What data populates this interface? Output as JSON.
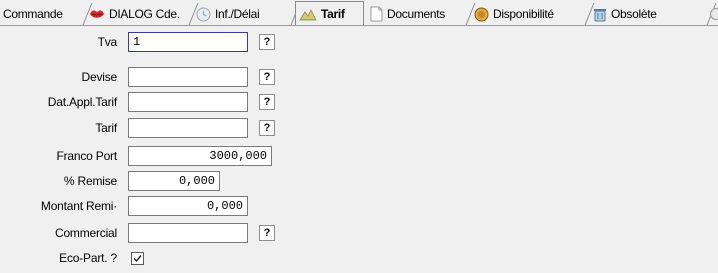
{
  "tabs": [
    {
      "label": "Commande",
      "icon": "none"
    },
    {
      "label": "DIALOG Cde.",
      "icon": "lips-icon"
    },
    {
      "label": "Inf./Délai",
      "icon": "clock-icon"
    },
    {
      "label": "Tarif",
      "icon": "scale-icon",
      "active": true
    },
    {
      "label": "Documents",
      "icon": "document-icon"
    },
    {
      "label": "Disponibilité",
      "icon": "coin-icon"
    },
    {
      "label": "Obsolète",
      "icon": "bin-icon"
    }
  ],
  "form": {
    "tva": {
      "label": "Tva",
      "value": "1",
      "help": "?"
    },
    "devise": {
      "label": "Devise",
      "value": "",
      "help": "?"
    },
    "dat_appl_tarif": {
      "label": "Dat.Appl.Tarif",
      "value": "",
      "help": "?"
    },
    "tarif": {
      "label": "Tarif",
      "value": "",
      "help": "?"
    },
    "franco_port": {
      "label": "Franco Port",
      "value": "3000,000"
    },
    "remise": {
      "label": "% Remise",
      "value": "0,000"
    },
    "montant_remise": {
      "label": "Montant Remi·",
      "value": "0,000"
    },
    "commercial": {
      "label": "Commercial",
      "value": "",
      "help": "?"
    },
    "eco_part": {
      "label": "Eco-Part. ?",
      "checked": true
    }
  }
}
